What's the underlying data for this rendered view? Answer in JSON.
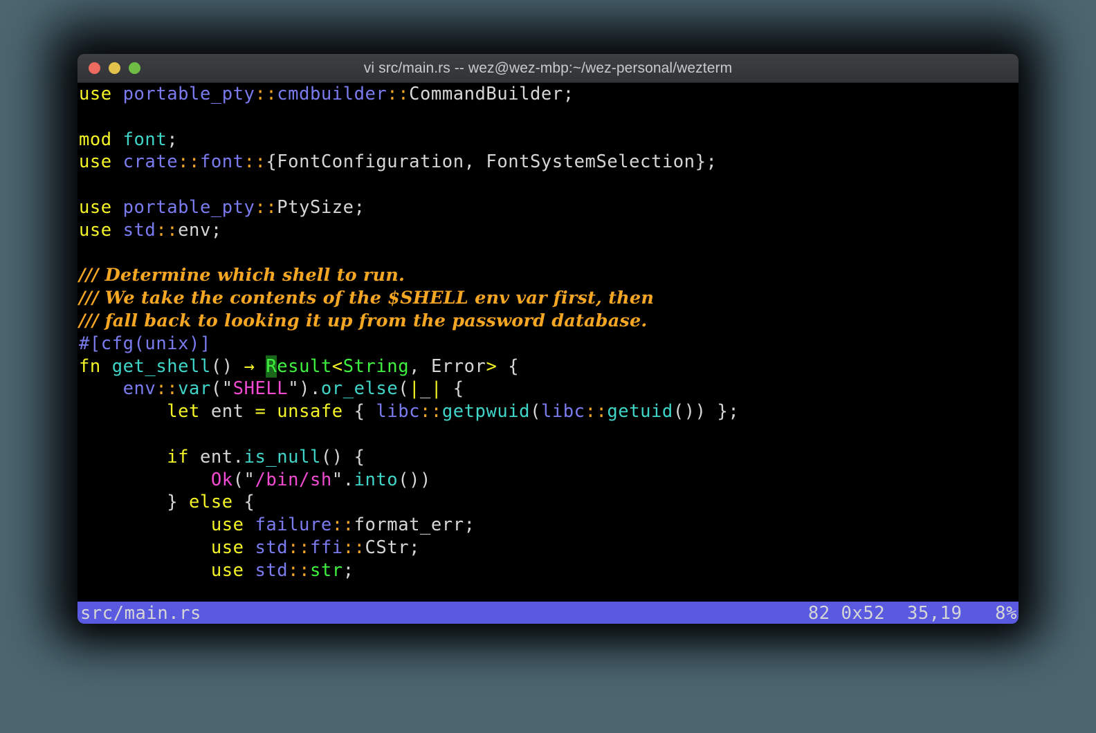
{
  "window": {
    "title": "vi src/main.rs -- wez@wez-mbp:~/wez-personal/wezterm",
    "controls": [
      {
        "name": "close",
        "color": "#ec6a5f"
      },
      {
        "name": "minimize",
        "color": "#e3c24c"
      },
      {
        "name": "zoom",
        "color": "#6fbd45"
      }
    ]
  },
  "editor": {
    "filename": "src/main.rs",
    "lines": [
      {
        "id": 1,
        "type": "code",
        "spans": [
          {
            "t": "use",
            "c": "kw"
          },
          {
            "t": " ",
            "c": "pun"
          },
          {
            "t": "portable_pty",
            "c": "mod"
          },
          {
            "t": "::",
            "c": "sep"
          },
          {
            "t": "cmdbuilder",
            "c": "mod"
          },
          {
            "t": "::",
            "c": "sep"
          },
          {
            "t": "CommandBuilder",
            "c": "type"
          },
          {
            "t": ";",
            "c": "pun"
          }
        ]
      },
      {
        "id": 2,
        "type": "blank",
        "spans": []
      },
      {
        "id": 3,
        "type": "code",
        "spans": [
          {
            "t": "mod",
            "c": "kw"
          },
          {
            "t": " ",
            "c": "pun"
          },
          {
            "t": "font",
            "c": "fnm"
          },
          {
            "t": ";",
            "c": "pun"
          }
        ]
      },
      {
        "id": 4,
        "type": "code",
        "spans": [
          {
            "t": "use",
            "c": "kw"
          },
          {
            "t": " ",
            "c": "pun"
          },
          {
            "t": "crate",
            "c": "mod"
          },
          {
            "t": "::",
            "c": "sep"
          },
          {
            "t": "font",
            "c": "mod"
          },
          {
            "t": "::",
            "c": "sep"
          },
          {
            "t": "{FontConfiguration, FontSystemSelection};",
            "c": "type"
          }
        ]
      },
      {
        "id": 5,
        "type": "blank",
        "spans": []
      },
      {
        "id": 6,
        "type": "code",
        "spans": [
          {
            "t": "use",
            "c": "kw"
          },
          {
            "t": " ",
            "c": "pun"
          },
          {
            "t": "portable_pty",
            "c": "mod"
          },
          {
            "t": "::",
            "c": "sep"
          },
          {
            "t": "PtySize",
            "c": "type"
          },
          {
            "t": ";",
            "c": "pun"
          }
        ]
      },
      {
        "id": 7,
        "type": "code",
        "spans": [
          {
            "t": "use",
            "c": "kw"
          },
          {
            "t": " ",
            "c": "pun"
          },
          {
            "t": "std",
            "c": "mod"
          },
          {
            "t": "::",
            "c": "sep"
          },
          {
            "t": "env",
            "c": "type"
          },
          {
            "t": ";",
            "c": "pun"
          }
        ]
      },
      {
        "id": 8,
        "type": "blank",
        "spans": []
      },
      {
        "id": 9,
        "type": "comment",
        "spans": [
          {
            "t": "/// Determine which shell to run.",
            "c": "cmt"
          }
        ]
      },
      {
        "id": 10,
        "type": "comment",
        "spans": [
          {
            "t": "/// We take the contents of the $SHELL env var first, then",
            "c": "cmt"
          }
        ]
      },
      {
        "id": 11,
        "type": "comment",
        "spans": [
          {
            "t": "/// fall back to looking it up from the password database.",
            "c": "cmt"
          }
        ]
      },
      {
        "id": 12,
        "type": "code",
        "spans": [
          {
            "t": "#[cfg(unix)]",
            "c": "attr"
          }
        ]
      },
      {
        "id": 13,
        "type": "code",
        "cursor": true,
        "spans": [
          {
            "t": "fn",
            "c": "kw"
          },
          {
            "t": " ",
            "c": "pun"
          },
          {
            "t": "get_shell",
            "c": "fnm"
          },
          {
            "t": "()",
            "c": "pun"
          },
          {
            "t": " ",
            "c": "pun"
          },
          {
            "t": "→",
            "c": "kw"
          },
          {
            "t": " ",
            "c": "pun"
          },
          {
            "t": "R",
            "c": "grn",
            "cursor": true
          },
          {
            "t": "esult",
            "c": "grn"
          },
          {
            "t": "<",
            "c": "kw"
          },
          {
            "t": "String",
            "c": "grn"
          },
          {
            "t": ", ",
            "c": "pun"
          },
          {
            "t": "Error",
            "c": "type"
          },
          {
            "t": ">",
            "c": "kw"
          },
          {
            "t": " {",
            "c": "pun"
          }
        ]
      },
      {
        "id": 14,
        "type": "code",
        "spans": [
          {
            "t": "    ",
            "c": "pun"
          },
          {
            "t": "env",
            "c": "mod"
          },
          {
            "t": "::",
            "c": "sep"
          },
          {
            "t": "var",
            "c": "fnm"
          },
          {
            "t": "(",
            "c": "pun"
          },
          {
            "t": "\"",
            "c": "pun"
          },
          {
            "t": "SHELL",
            "c": "mag"
          },
          {
            "t": "\"",
            "c": "pun"
          },
          {
            "t": ")",
            "c": "pun"
          },
          {
            "t": ".",
            "c": "pun"
          },
          {
            "t": "or_else",
            "c": "fnm"
          },
          {
            "t": "(",
            "c": "pun"
          },
          {
            "t": "|",
            "c": "kw"
          },
          {
            "t": "_",
            "c": "pun"
          },
          {
            "t": "|",
            "c": "kw"
          },
          {
            "t": " {",
            "c": "pun"
          }
        ]
      },
      {
        "id": 15,
        "type": "code",
        "spans": [
          {
            "t": "        ",
            "c": "pun"
          },
          {
            "t": "let",
            "c": "kw"
          },
          {
            "t": " ",
            "c": "pun"
          },
          {
            "t": "ent",
            "c": "type"
          },
          {
            "t": " ",
            "c": "pun"
          },
          {
            "t": "=",
            "c": "kw"
          },
          {
            "t": " ",
            "c": "pun"
          },
          {
            "t": "unsafe",
            "c": "kw"
          },
          {
            "t": " { ",
            "c": "pun"
          },
          {
            "t": "libc",
            "c": "mod"
          },
          {
            "t": "::",
            "c": "sep"
          },
          {
            "t": "getpwuid",
            "c": "fnm"
          },
          {
            "t": "(",
            "c": "pun"
          },
          {
            "t": "libc",
            "c": "mod"
          },
          {
            "t": "::",
            "c": "sep"
          },
          {
            "t": "getuid",
            "c": "fnm"
          },
          {
            "t": "()) };",
            "c": "pun"
          }
        ]
      },
      {
        "id": 16,
        "type": "blank",
        "spans": []
      },
      {
        "id": 17,
        "type": "code",
        "spans": [
          {
            "t": "        ",
            "c": "pun"
          },
          {
            "t": "if",
            "c": "kw"
          },
          {
            "t": " ",
            "c": "pun"
          },
          {
            "t": "ent",
            "c": "type"
          },
          {
            "t": ".",
            "c": "pun"
          },
          {
            "t": "is_null",
            "c": "fnm"
          },
          {
            "t": "() {",
            "c": "pun"
          }
        ]
      },
      {
        "id": 18,
        "type": "code",
        "spans": [
          {
            "t": "            ",
            "c": "pun"
          },
          {
            "t": "Ok",
            "c": "mag"
          },
          {
            "t": "(",
            "c": "pun"
          },
          {
            "t": "\"",
            "c": "pun"
          },
          {
            "t": "/bin/sh",
            "c": "mag"
          },
          {
            "t": "\"",
            "c": "pun"
          },
          {
            "t": ".",
            "c": "pun"
          },
          {
            "t": "into",
            "c": "fnm"
          },
          {
            "t": "())",
            "c": "pun"
          }
        ]
      },
      {
        "id": 19,
        "type": "code",
        "spans": [
          {
            "t": "        } ",
            "c": "pun"
          },
          {
            "t": "else",
            "c": "kw"
          },
          {
            "t": " {",
            "c": "pun"
          }
        ]
      },
      {
        "id": 20,
        "type": "code",
        "spans": [
          {
            "t": "            ",
            "c": "pun"
          },
          {
            "t": "use",
            "c": "kw"
          },
          {
            "t": " ",
            "c": "pun"
          },
          {
            "t": "failure",
            "c": "mod"
          },
          {
            "t": "::",
            "c": "sep"
          },
          {
            "t": "format_err",
            "c": "type"
          },
          {
            "t": ";",
            "c": "pun"
          }
        ]
      },
      {
        "id": 21,
        "type": "code",
        "spans": [
          {
            "t": "            ",
            "c": "pun"
          },
          {
            "t": "use",
            "c": "kw"
          },
          {
            "t": " ",
            "c": "pun"
          },
          {
            "t": "std",
            "c": "mod"
          },
          {
            "t": "::",
            "c": "sep"
          },
          {
            "t": "ffi",
            "c": "mod"
          },
          {
            "t": "::",
            "c": "sep"
          },
          {
            "t": "CStr",
            "c": "type"
          },
          {
            "t": ";",
            "c": "pun"
          }
        ]
      },
      {
        "id": 22,
        "type": "code",
        "spans": [
          {
            "t": "            ",
            "c": "pun"
          },
          {
            "t": "use",
            "c": "kw"
          },
          {
            "t": " ",
            "c": "pun"
          },
          {
            "t": "std",
            "c": "mod"
          },
          {
            "t": "::",
            "c": "sep"
          },
          {
            "t": "str",
            "c": "grn"
          },
          {
            "t": ";",
            "c": "pun"
          }
        ]
      }
    ]
  },
  "statusline": {
    "left": "src/main.rs",
    "right": "82 0x52  35,19   8%",
    "background": "#5a5ae0",
    "foreground": "#d6d6d6"
  },
  "theme": {
    "terminal_background": "#000000",
    "desktop_background": "#4c6670",
    "titlebar_background": "#353739",
    "keyword": "#f4f427",
    "module": "#7b7bf0",
    "separator": "#f5a623",
    "function": "#3fd5c8",
    "green": "#3ff23f",
    "magenta": "#f24ad0",
    "comment": "#f5a623",
    "text": "#d6d6d6",
    "cursor": "#3ff23f"
  }
}
